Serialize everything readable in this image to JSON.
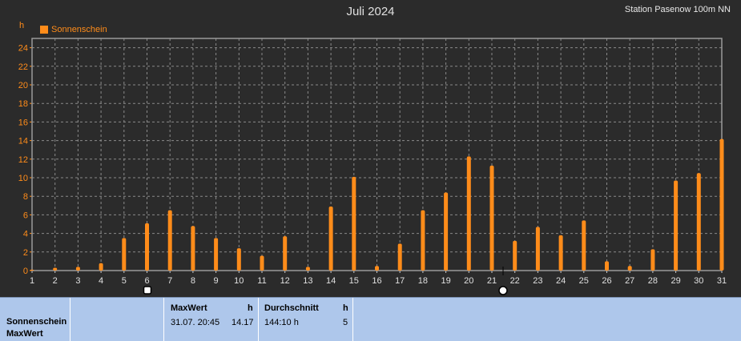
{
  "header": {
    "title": "Juli 2024",
    "station": "Station Pasenow 100m NN",
    "unit": "h"
  },
  "legend": {
    "label": "Sonnenschein",
    "color": "#ff8c1a"
  },
  "chart_data": {
    "type": "bar",
    "title": "Juli 2024",
    "xlabel": "",
    "ylabel": "h",
    "categories": [
      "1",
      "2",
      "3",
      "4",
      "5",
      "6",
      "7",
      "8",
      "9",
      "10",
      "11",
      "12",
      "13",
      "14",
      "15",
      "16",
      "17",
      "18",
      "19",
      "20",
      "21",
      "22",
      "23",
      "24",
      "25",
      "26",
      "27",
      "28",
      "29",
      "30",
      "31"
    ],
    "series": [
      {
        "name": "Sonnenschein",
        "color": "#ff8c1a",
        "values": [
          0.1,
          0.3,
          0.4,
          0.8,
          3.5,
          5.1,
          6.5,
          4.8,
          3.5,
          2.4,
          1.6,
          3.7,
          0.4,
          6.9,
          10.1,
          0.5,
          2.9,
          6.5,
          8.4,
          12.3,
          11.3,
          3.2,
          4.7,
          3.8,
          5.4,
          1.0,
          0.5,
          2.3,
          9.7,
          10.5,
          14.17
        ]
      }
    ],
    "ylim": [
      0,
      25
    ],
    "yticks": [
      0,
      2,
      4,
      6,
      8,
      10,
      12,
      14,
      16,
      18,
      20,
      22,
      24
    ],
    "grid": true,
    "legend_position": "top-left"
  },
  "panel": {
    "row_labels": [
      "Sonnenschein",
      "MaxWert"
    ],
    "max_header": "MaxWert",
    "max_unit": "h",
    "max_datetime": "31.07.  20:45",
    "max_value": "14.17",
    "avg_header": "Durchschnitt",
    "avg_unit": "h",
    "avg_total": "144:10 h",
    "avg_value": "5"
  }
}
